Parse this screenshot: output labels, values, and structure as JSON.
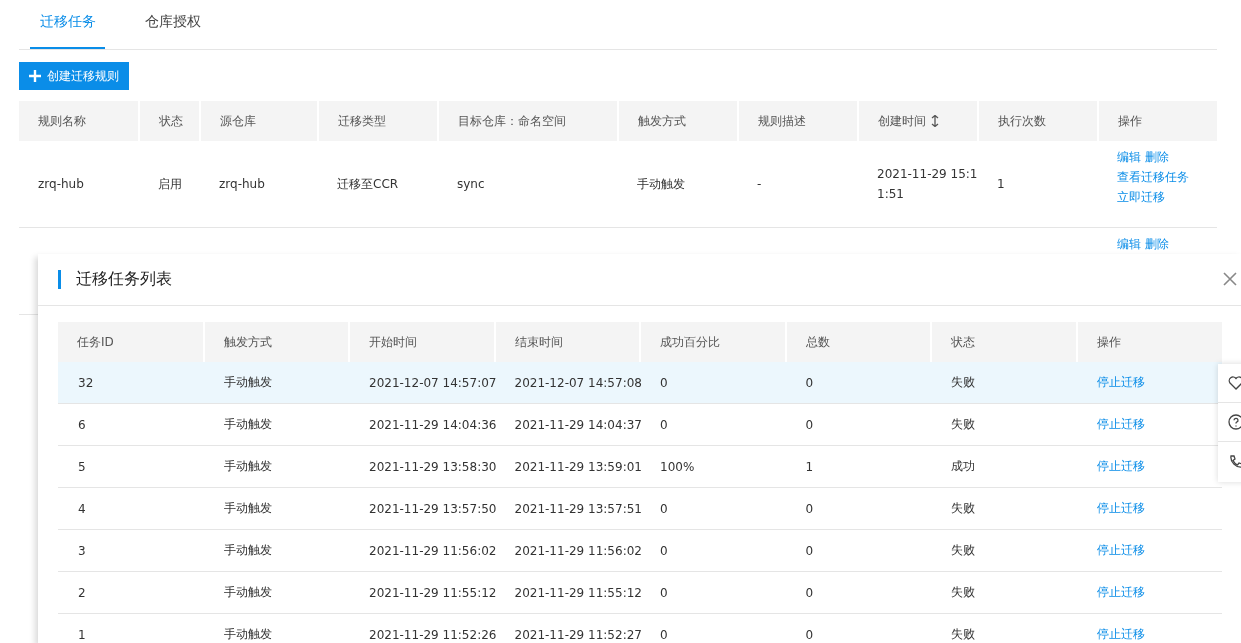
{
  "tabs": [
    {
      "label": "迁移任务",
      "selected": true
    },
    {
      "label": "仓库授权",
      "selected": false
    }
  ],
  "create_button": {
    "label": "创建迁移规则"
  },
  "rules_table": {
    "columns": [
      {
        "label": "规则名称"
      },
      {
        "label": "状态"
      },
      {
        "label": "源仓库"
      },
      {
        "label": "迁移类型"
      },
      {
        "label": "目标仓库：命名空间"
      },
      {
        "label": "触发方式"
      },
      {
        "label": "规则描述"
      },
      {
        "label": "创建时间",
        "sortable": true
      },
      {
        "label": "执行次数"
      },
      {
        "label": "操作"
      }
    ],
    "rows": [
      {
        "cells": [
          "zrq-hub",
          "启用",
          "zrq-hub",
          "迁移至CCR",
          "sync",
          "手动触发",
          "-",
          "2021-11-29 15:1\n1:51",
          "1"
        ],
        "actions": [
          [
            "编辑",
            "删除"
          ],
          [
            "查看迁移任务"
          ],
          [
            "立即迁移"
          ]
        ]
      },
      {
        "cells": [],
        "actions": [
          [
            "编辑",
            "删除"
          ]
        ]
      }
    ]
  },
  "drawer": {
    "title": "迁移任务列表",
    "columns": [
      "任务ID",
      "触发方式",
      "开始时间",
      "结束时间",
      "成功百分比",
      "总数",
      "状态",
      "操作"
    ],
    "rows": [
      {
        "selected": true,
        "cells": [
          "32",
          "手动触发",
          "2021-12-07 14:57:07",
          "2021-12-07 14:57:08",
          "0",
          "0",
          "失败"
        ],
        "action": "停止迁移"
      },
      {
        "selected": false,
        "cells": [
          "6",
          "手动触发",
          "2021-11-29 14:04:36",
          "2021-11-29 14:04:37",
          "0",
          "0",
          "失败"
        ],
        "action": "停止迁移"
      },
      {
        "selected": false,
        "cells": [
          "5",
          "手动触发",
          "2021-11-29 13:58:30",
          "2021-11-29 13:59:01",
          "100%",
          "1",
          "成功"
        ],
        "action": "停止迁移"
      },
      {
        "selected": false,
        "cells": [
          "4",
          "手动触发",
          "2021-11-29 13:57:50",
          "2021-11-29 13:57:51",
          "0",
          "0",
          "失败"
        ],
        "action": "停止迁移"
      },
      {
        "selected": false,
        "cells": [
          "3",
          "手动触发",
          "2021-11-29 11:56:02",
          "2021-11-29 11:56:02",
          "0",
          "0",
          "失败"
        ],
        "action": "停止迁移"
      },
      {
        "selected": false,
        "cells": [
          "2",
          "手动触发",
          "2021-11-29 11:55:12",
          "2021-11-29 11:55:12",
          "0",
          "0",
          "失败"
        ],
        "action": "停止迁移"
      },
      {
        "selected": false,
        "cells": [
          "1",
          "手动触发",
          "2021-11-29 11:52:26",
          "2021-11-29 11:52:27",
          "0",
          "0",
          "失败"
        ],
        "action": "停止迁移"
      }
    ]
  }
}
